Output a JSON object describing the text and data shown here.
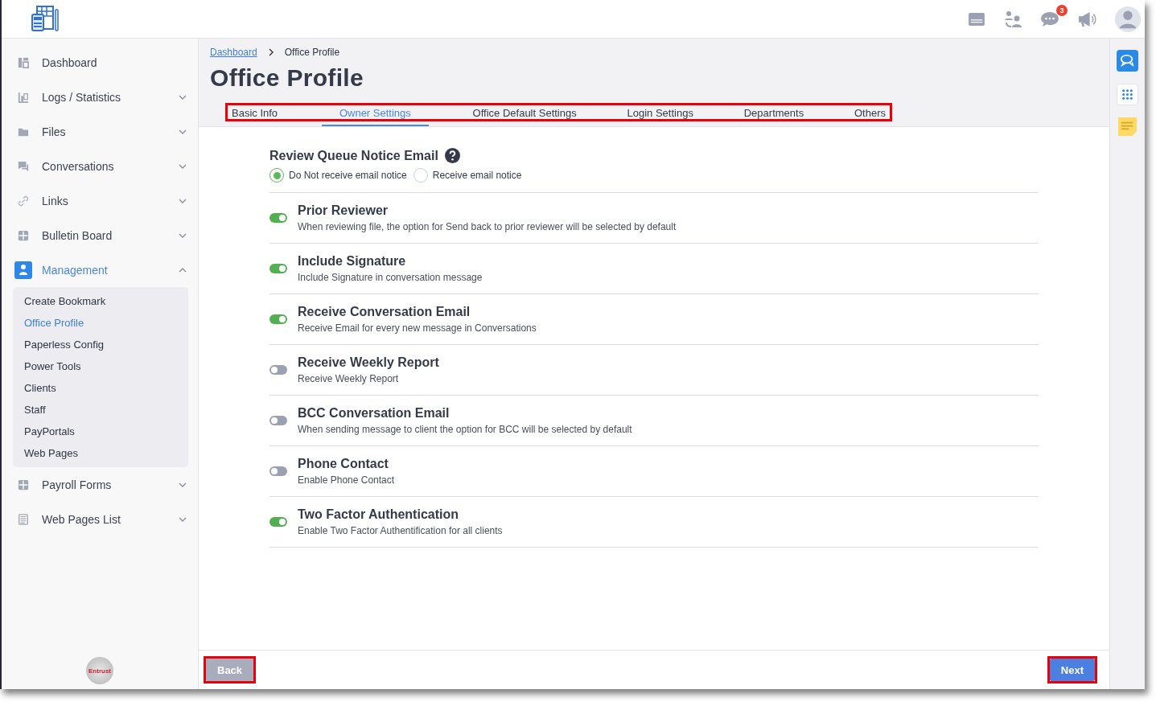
{
  "header": {
    "notification_count": "3"
  },
  "sidebar": {
    "items": [
      {
        "label": "Dashboard",
        "selected": false
      },
      {
        "label": "Logs / Statistics",
        "expandable": true,
        "expanded": false,
        "selected": false
      },
      {
        "label": "Files",
        "expandable": true,
        "expanded": false,
        "selected": false
      },
      {
        "label": "Conversations",
        "expandable": true,
        "expanded": false,
        "selected": false
      },
      {
        "label": "Links",
        "expandable": true,
        "expanded": false,
        "selected": false
      },
      {
        "label": "Bulletin Board",
        "expandable": true,
        "expanded": false,
        "selected": false
      },
      {
        "label": "Management",
        "expandable": true,
        "expanded": true,
        "selected": true,
        "children": [
          {
            "label": "Create Bookmark",
            "selected": false
          },
          {
            "label": "Office Profile",
            "selected": true
          },
          {
            "label": "Paperless Config",
            "selected": false
          },
          {
            "label": "Power Tools",
            "selected": false
          },
          {
            "label": "Clients",
            "selected": false
          },
          {
            "label": "Staff",
            "selected": false
          },
          {
            "label": "PayPortals",
            "selected": false
          },
          {
            "label": "Web Pages",
            "selected": false
          }
        ]
      },
      {
        "label": "Payroll Forms",
        "expandable": true,
        "expanded": false,
        "selected": false
      },
      {
        "label": "Web Pages List",
        "expandable": true,
        "expanded": false,
        "selected": false
      }
    ],
    "seal": "Entrust"
  },
  "breadcrumb": [
    {
      "label": "Dashboard",
      "kind": "link"
    },
    {
      "label": "Office Profile",
      "kind": "current"
    }
  ],
  "page_title": "Office Profile",
  "tabs": {
    "highlighted": true,
    "items": [
      {
        "label": "Basic Info",
        "selected": false
      },
      {
        "label": "Owner Settings",
        "selected": true
      },
      {
        "label": "Office Default Settings",
        "selected": false
      },
      {
        "label": "Login Settings",
        "selected": false
      },
      {
        "label": "Departments",
        "selected": false
      },
      {
        "label": "Others",
        "selected": false
      }
    ]
  },
  "review_queue": {
    "title": "Review Queue Notice Email",
    "options": [
      {
        "label": "Do Not receive email notice",
        "selected": true
      },
      {
        "label": "Receive email notice",
        "selected": false
      }
    ]
  },
  "settings": [
    {
      "title": "Prior Reviewer",
      "description": "When reviewing file, the option for Send back to prior reviewer will be selected by default",
      "on": true
    },
    {
      "title": "Include Signature",
      "description": "Include Signature in conversation message",
      "on": true
    },
    {
      "title": "Receive Conversation Email",
      "description": "Receive Email for every new message in Conversations",
      "on": true
    },
    {
      "title": "Receive Weekly Report",
      "description": "Receive Weekly Report",
      "on": false
    },
    {
      "title": "BCC Conversation Email",
      "description": "When sending message to client the option for BCC will be selected by default",
      "on": false
    },
    {
      "title": "Phone Contact",
      "description": "Enable Phone Contact",
      "on": false
    },
    {
      "title": "Two Factor Authentication",
      "description": "Enable Two Factor Authentification for all clients",
      "on": true
    }
  ],
  "footer": {
    "buttons": [
      {
        "label": "Back",
        "kind": "back",
        "disabled": true,
        "highlighted": true
      },
      {
        "label": "Next",
        "kind": "next",
        "disabled": false,
        "highlighted": true
      }
    ]
  }
}
